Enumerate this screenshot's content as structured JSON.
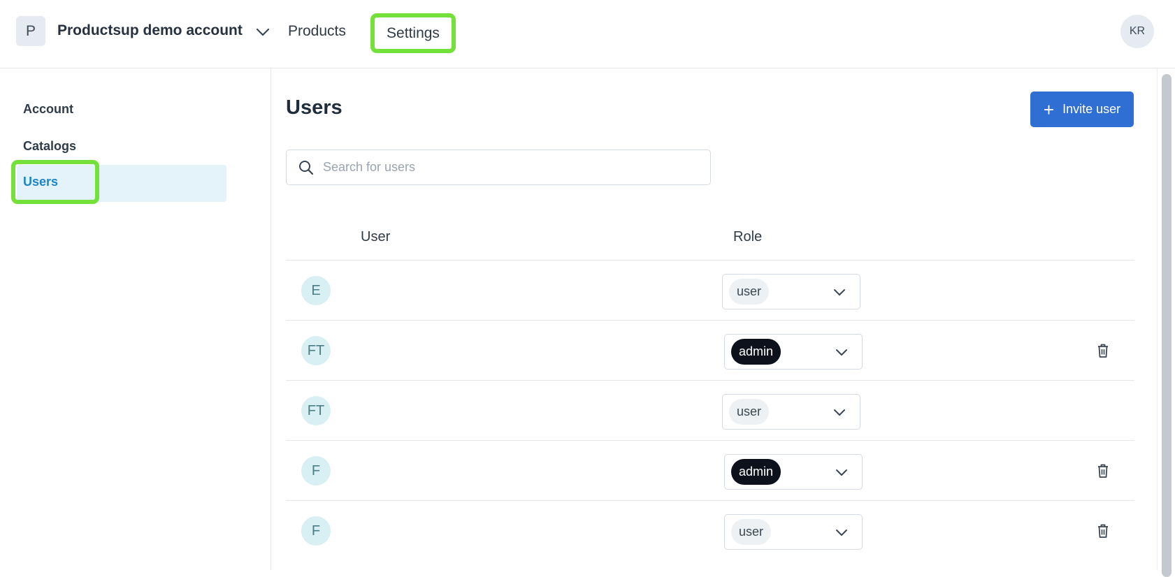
{
  "header": {
    "account_initial": "P",
    "account_name": "Productsup demo account",
    "nav": {
      "products_label": "Products",
      "settings_label": "Settings"
    },
    "user_initials": "KR"
  },
  "sidebar": {
    "items": [
      {
        "label": "Account"
      },
      {
        "label": "Catalogs"
      },
      {
        "label": "Users",
        "active": true
      }
    ]
  },
  "main": {
    "title": "Users",
    "invite_label": "Invite user",
    "search": {
      "placeholder": "Search for users",
      "value": ""
    },
    "table": {
      "columns": [
        "User",
        "Role"
      ],
      "rows": [
        {
          "initials": "E",
          "role": "user",
          "deletable": false
        },
        {
          "initials": "FT",
          "role": "admin",
          "deletable": true
        },
        {
          "initials": "FT",
          "role": "user",
          "deletable": false
        },
        {
          "initials": "F",
          "role": "admin",
          "deletable": true
        },
        {
          "initials": "F",
          "role": "user",
          "deletable": true
        }
      ]
    }
  },
  "colors": {
    "accent": "#2f6fd4",
    "active_nav_text": "#1b86c8",
    "active_nav_bg": "#e4f2fa",
    "highlight_outline": "#74e13a",
    "admin_chip": "#0c111c",
    "user_chip": "#eef1f4",
    "avatar_bg": "#d8f0f4"
  },
  "icons": {
    "account_dropdown": "chevron-down-icon",
    "search": "search-icon",
    "invite": "plus-icon",
    "role_dropdown": "chevron-down-icon",
    "delete": "trash-icon"
  }
}
